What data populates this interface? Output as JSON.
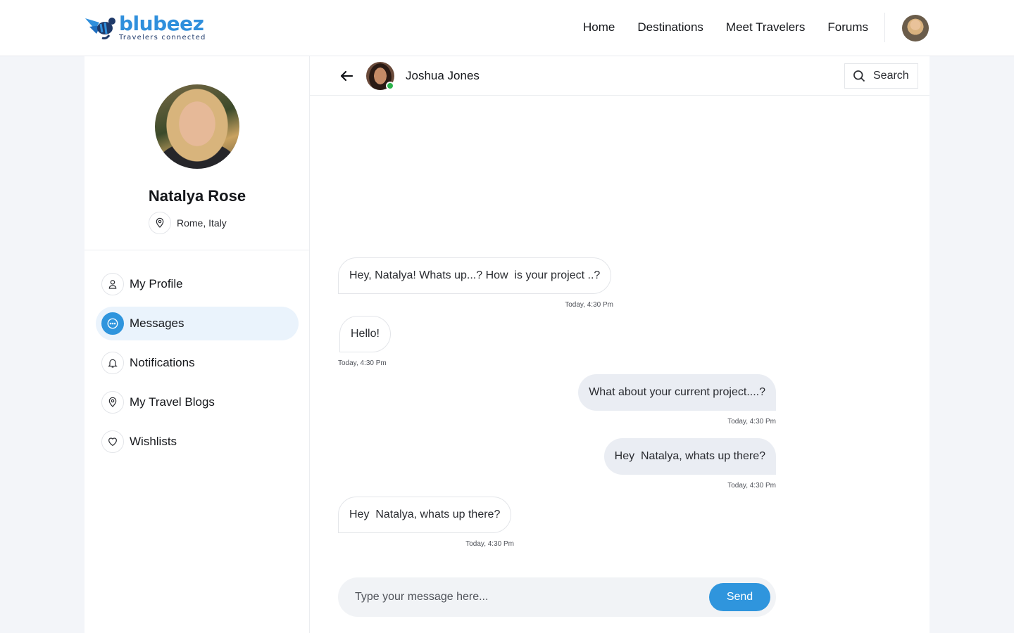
{
  "brand": {
    "name": "blubeez",
    "tagline": "Travelers connected",
    "color": "#2f8fdc"
  },
  "nav": {
    "items": [
      {
        "label": "Home"
      },
      {
        "label": "Destinations"
      },
      {
        "label": "Meet Travelers"
      },
      {
        "label": "Forums"
      }
    ]
  },
  "profile": {
    "name": "Natalya Rose",
    "location": "Rome, Italy"
  },
  "menu": {
    "items": [
      {
        "label": "My Profile",
        "icon": "user-icon"
      },
      {
        "label": "Messages",
        "icon": "chat-icon",
        "active": true
      },
      {
        "label": "Notifications",
        "icon": "bell-icon"
      },
      {
        "label": "My Travel Blogs",
        "icon": "map-pin-icon"
      },
      {
        "label": "Wishlists",
        "icon": "heart-icon"
      }
    ]
  },
  "chat": {
    "contact_name": "Joshua Jones",
    "contact_status": "online",
    "search_label": "Search",
    "messages": [
      {
        "direction": "incoming",
        "text": "Hey, Natalya! Whats up...? How  is your project ..?",
        "time": "Today, 4:30 Pm"
      },
      {
        "direction": "incoming",
        "text": "Hello!",
        "time": "Today, 4:30 Pm"
      },
      {
        "direction": "outgoing",
        "text": "What about your current project....?",
        "time": "Today, 4:30 Pm"
      },
      {
        "direction": "outgoing",
        "text": "Hey  Natalya, whats up there?",
        "time": "Today, 4:30 Pm"
      },
      {
        "direction": "incoming",
        "text": "Hey  Natalya, whats up there?",
        "time": "Today, 4:30 Pm"
      }
    ],
    "composer": {
      "placeholder": "Type your message here...",
      "value": "",
      "send_label": "Send"
    }
  },
  "colors": {
    "accent": "#2f95dd",
    "active_menu_bg": "#eaf3fc",
    "online": "#2bb24c",
    "outgoing_bubble": "#eaedf3"
  }
}
